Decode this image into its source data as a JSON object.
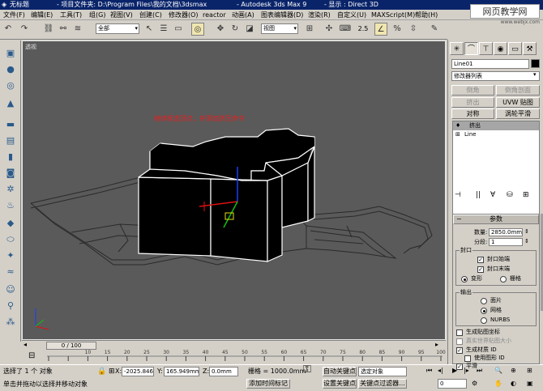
{
  "window": {
    "app_name": "无标题",
    "project_folder": "- 项目文件夹: D:\\Program Files\\我的文档\\3dsmax",
    "app_title": "- Autodesk 3ds Max 9",
    "display": "- 显示 : Direct 3D"
  },
  "watermark": {
    "text": "网页教学网",
    "url": "www.webjx.com"
  },
  "menu": [
    "文件(F)",
    "编辑(E)",
    "工具(T)",
    "组(G)",
    "视图(V)",
    "创建(C)",
    "修改器(O)",
    "reactor",
    "动画(A)",
    "图表编辑器(D)",
    "渲染(R)",
    "自定义(U)",
    "MAXScript(M)",
    "帮助(H)"
  ],
  "toolbar": {
    "selection_filter": "全部",
    "ref_coord": "视图",
    "snap_value": "2.5"
  },
  "viewport": {
    "label": "透视",
    "note": "继续框选顶点，并添加挤压命令",
    "frame_counter": "0 / 100"
  },
  "timeline_ticks": [
    "10",
    "15",
    "20",
    "25",
    "30",
    "35",
    "40",
    "45",
    "50",
    "55",
    "60",
    "65",
    "70",
    "75",
    "80",
    "85",
    "90",
    "95",
    "100"
  ],
  "status": {
    "selected": "选择了 1 个 对象",
    "prompt": "单击并拖动以选择并移动对象",
    "x_label": "X:",
    "x_value": "-2025.846",
    "y_label": "Y:",
    "y_value": "165.949mm",
    "z_label": "Z:",
    "z_value": "0.0mm",
    "grid": "栅格 = 1000.0mm",
    "add_time_tag": "添加时间标记",
    "auto_key": "自动关键点",
    "set_key": "设置关键点",
    "selected_object": "选定对象",
    "key_filter": "关键点过滤器...",
    "frame": "0"
  },
  "cmdpanel": {
    "object_name": "Line01",
    "modifier_list": "修改器列表",
    "buttons": [
      "倒角",
      "倒角剖面",
      "挤出",
      "UVW 贴图",
      "对称",
      "涡轮平滑"
    ],
    "stack": [
      {
        "label": "挤出",
        "selected": true
      },
      {
        "label": "Line",
        "selected": false
      }
    ],
    "params_title": "参数",
    "amount_label": "数量:",
    "amount_value": "2850.0mm",
    "segments_label": "分段:",
    "segments_value": "1",
    "capping_title": "封口",
    "cap_start": "封口始端",
    "cap_end": "封口末端",
    "morph": "变形",
    "grid_opt": "栅格",
    "output_title": "输出",
    "patch": "面片",
    "mesh": "网格",
    "nurbs": "NURBS",
    "gen_mapping": "生成贴图坐标",
    "real_world": "真实世界贴图大小",
    "gen_mat_ids": "生成材质 ID",
    "use_shape_ids": "使用图形 ID",
    "smooth": "平滑"
  },
  "colors": {
    "title_bar": "#0a246a",
    "viewport_bg": "#5a5a5a",
    "panel_bg": "#d4d0c8",
    "note_color": "#e82020"
  }
}
